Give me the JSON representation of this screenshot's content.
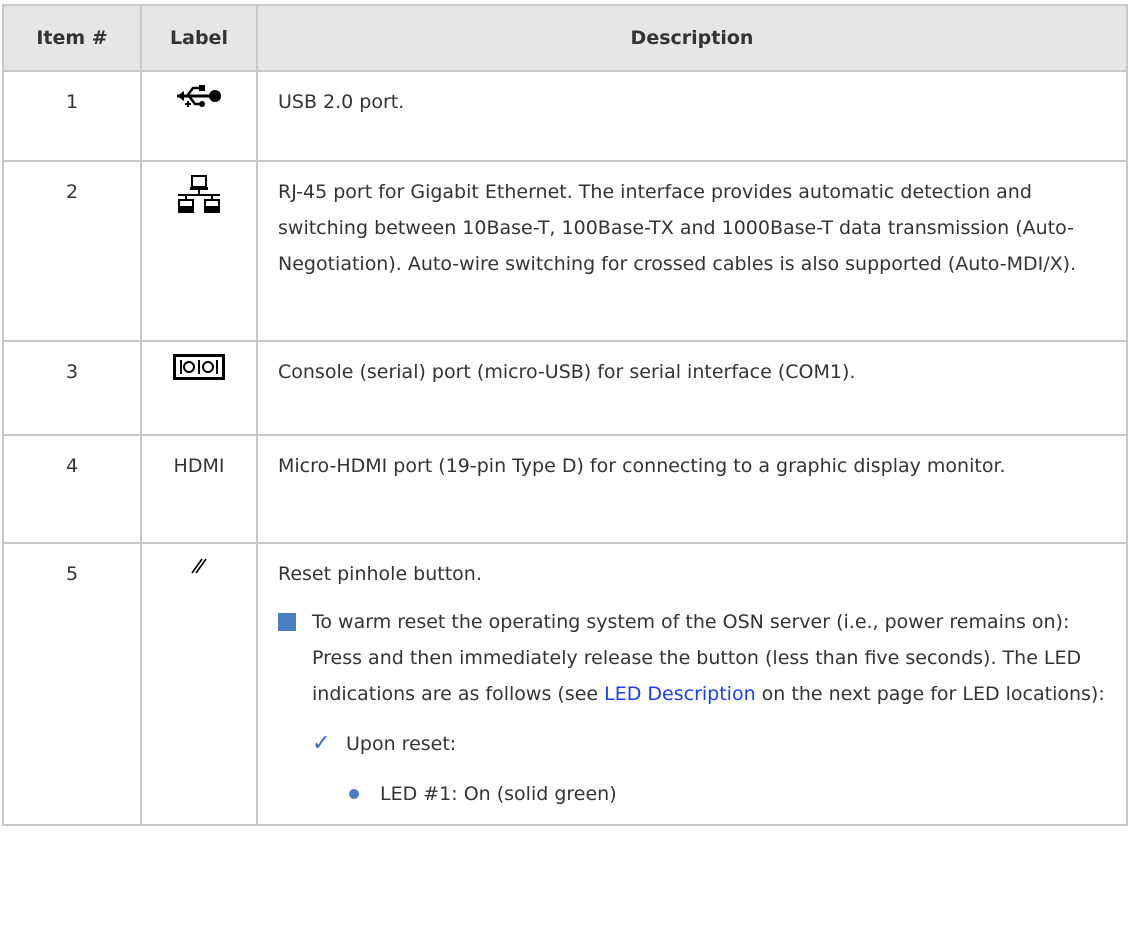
{
  "headers": {
    "item": "Item #",
    "label": "Label",
    "description": "Description"
  },
  "rows": [
    {
      "item": "1",
      "label_icon": "usb-icon",
      "description": "USB 2.0 port."
    },
    {
      "item": "2",
      "label_icon": "network-icon",
      "description": "RJ-45 port for Gigabit Ethernet. The interface provides automatic detection and switching between 10Base-T, 100Base-TX and 1000Base-T data transmission (Auto-Negotiation). Auto-wire switching for crossed cables is also supported (Auto-MDI/X)."
    },
    {
      "item": "3",
      "label_icon": "serial-port-icon",
      "description": "Console (serial) port (micro-USB) for serial interface (COM1)."
    },
    {
      "item": "4",
      "label": "HDMI",
      "description": "Micro-HDMI port (19-pin Type D) for connecting to a graphic display monitor."
    },
    {
      "item": "5",
      "label_icon": "reset-pinhole-icon",
      "description": "Reset pinhole button.",
      "bullet_text_before": "To warm reset the operating system of the OSN server (i.e., power remains on): Press and then immediately release the button (less than five seconds). The LED indications are as follows (see ",
      "bullet_link": "LED Description",
      "bullet_text_after": " on the next page for LED locations):",
      "check_text": "Upon reset:",
      "dot_text": "LED #1: On (solid green)"
    }
  ],
  "colors": {
    "bullet": "#4b7fc4",
    "link": "#1a3ff0",
    "header_bg": "#e6e6e6"
  }
}
